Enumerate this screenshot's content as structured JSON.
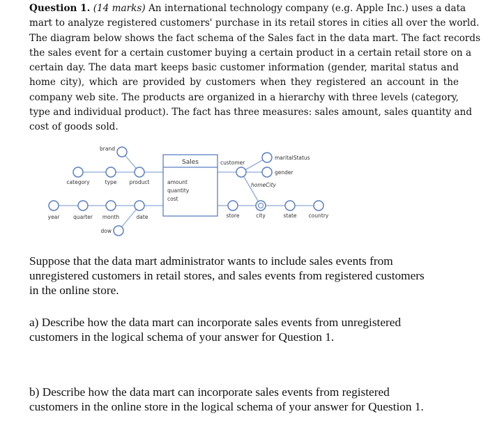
{
  "question": {
    "label": "Question 1.",
    "marks": "(14 marks)",
    "lines": [
      " An international technology company (e.g. Apple Inc.) uses a data",
      "mart to analyze registered customers' purchase in its retail stores in cities all over the world.",
      "The diagram below shows the fact schema of the Sales fact in the data mart. The fact records",
      "the sales event for a certain customer buying a certain product in a certain retail store on a",
      "certain day. The data mart keeps basic customer information (gender, marital status and",
      "home city), which are provided by customers when they registered an account in the",
      "company web site. The products are organized in a hierarchy with three levels (category,",
      "type and individual product). The fact has three measures: sales amount, sales quantity and",
      "cost of goods sold."
    ]
  },
  "diagram": {
    "fact": "Sales",
    "measures": [
      "amount",
      "quantity",
      "cost"
    ],
    "nodes": {
      "brand": "brand",
      "category": "category",
      "type": "type",
      "product": "product",
      "year": "year",
      "quarter": "quarter",
      "month": "month",
      "date": "date",
      "dow": "dow",
      "customer": "customer",
      "maritalStatus": "maritalStatus",
      "gender": "gender",
      "homeCity": "homeCity",
      "store": "store",
      "city": "city",
      "state": "state",
      "country": "country"
    },
    "line_color": "#8fa9d6",
    "node_color": "#5b7fc0"
  },
  "intro": [
    "Suppose that the data mart administrator wants to include sales events from",
    "unregistered customers in retail stores, and sales events from registered customers",
    "in the online store."
  ],
  "part_a": [
    "a) Describe how the data mart can incorporate sales events from unregistered",
    "customers in the logical schema of your answer for Question 1."
  ],
  "part_b": [
    "b) Describe how the data mart can incorporate sales events from registered",
    "customers in the online store in the logical schema of your answer for Question 1."
  ]
}
